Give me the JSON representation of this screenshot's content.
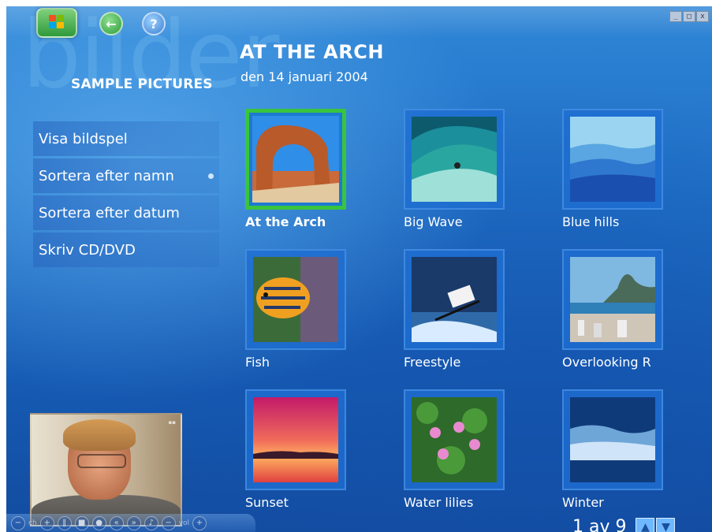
{
  "watermark_text": "bilder",
  "window": {
    "minimize": "_",
    "maximize": "□",
    "close": "x"
  },
  "top_nav": {
    "back_glyph": "←",
    "help_glyph": "?"
  },
  "section_title": "SAMPLE PICTURES",
  "menu": [
    {
      "label": "Visa bildspel"
    },
    {
      "label": "Sortera efter namn"
    },
    {
      "label": "Sortera efter datum"
    },
    {
      "label": "Skriv CD/DVD"
    }
  ],
  "header": {
    "title": "AT THE ARCH",
    "subtitle": "den 14 januari 2004"
  },
  "pictures": [
    {
      "caption": "At the Arch",
      "icon": "arch-photo"
    },
    {
      "caption": "Big Wave",
      "icon": "wave-photo"
    },
    {
      "caption": "Blue hills",
      "icon": "hills-photo"
    },
    {
      "caption": "Fish",
      "icon": "fish-photo"
    },
    {
      "caption": "Freestyle",
      "icon": "skier-photo"
    },
    {
      "caption": "Overlooking R",
      "icon": "city-photo"
    },
    {
      "caption": "Sunset",
      "icon": "sunset-photo"
    },
    {
      "caption": "Water lilies",
      "icon": "lilies-photo"
    },
    {
      "caption": "Winter",
      "icon": "winter-photo"
    }
  ],
  "transport": {
    "ch_label": "ch",
    "vol_label": "vol",
    "minus": "−",
    "plus": "+"
  },
  "pager": {
    "text": "1 av 9",
    "up": "▲",
    "down": "▼"
  },
  "colors": {
    "accent_green": "#39c43f",
    "bg_blue": "#1f6fc7"
  }
}
